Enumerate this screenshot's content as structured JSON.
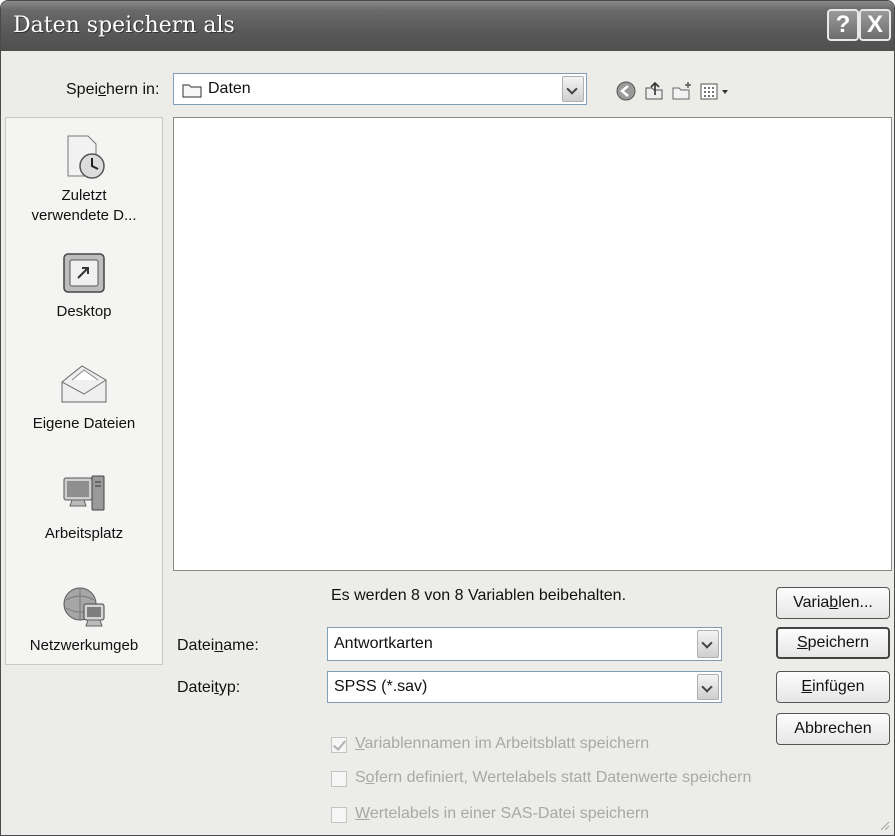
{
  "window": {
    "title": "Daten speichern als",
    "help_button": "?",
    "close_button": "X"
  },
  "save_in": {
    "label_pre": "Spei",
    "label_key": "c",
    "label_post": "hern in:",
    "value": "Daten"
  },
  "toolbar_icons": [
    "back-icon",
    "up-folder-icon",
    "new-folder-icon",
    "view-menu-icon"
  ],
  "places": [
    {
      "id": "recent",
      "label_line1": "Zuletzt",
      "label_line2": "verwendete D...",
      "icon": "recent-documents-icon"
    },
    {
      "id": "desktop",
      "label_line1": "Desktop",
      "icon": "desktop-icon"
    },
    {
      "id": "my-documents",
      "label_line1": "Eigene Dateien",
      "icon": "my-documents-icon"
    },
    {
      "id": "my-computer",
      "label_line1": "Arbeitsplatz",
      "icon": "my-computer-icon"
    },
    {
      "id": "network",
      "label_line1": "Netzwerkumgeb",
      "icon": "network-icon"
    }
  ],
  "info_text": "Es werden 8 von 8 Variablen beibehalten.",
  "filename": {
    "label_pre": "Datei",
    "label_key": "n",
    "label_post": "ame:",
    "value": "Antwortkarten"
  },
  "filetype": {
    "label_pre": "Datei",
    "label_key": "t",
    "label_post": "yp:",
    "value": "SPSS (*.sav)"
  },
  "buttons": {
    "variables": {
      "pre": "Varia",
      "key": "b",
      "post": "len..."
    },
    "save": {
      "pre": "",
      "key": "S",
      "post": "peichern"
    },
    "paste": {
      "pre": "",
      "key": "E",
      "post": "infügen"
    },
    "cancel": {
      "label": "Abbrechen"
    }
  },
  "checkboxes": [
    {
      "key": "V",
      "post": "ariablennamen im Arbeitsblatt speichern",
      "pre": "",
      "checked": true
    },
    {
      "pre": "S",
      "key": "o",
      "post": "fern definiert, Wertelabels statt Datenwerte speichern",
      "checked": false
    },
    {
      "key": "W",
      "post": "ertelabels in einer SAS-Datei speichern",
      "pre": "",
      "checked": false
    }
  ],
  "colors": {
    "titlebar": "#595959",
    "dialog_bg": "#ecece9",
    "disabled_text": "#a8a8a8"
  }
}
